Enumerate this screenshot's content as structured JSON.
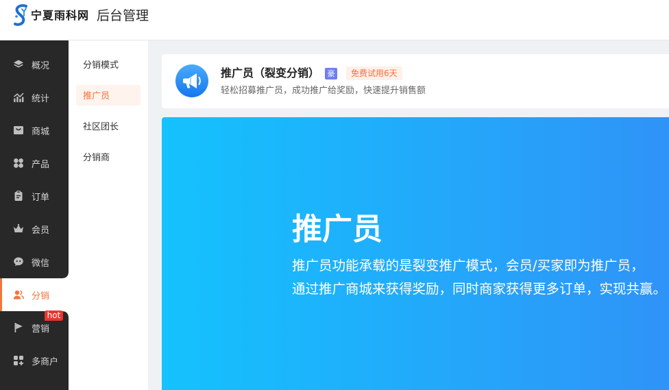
{
  "header": {
    "logo_text": "宁夏雨科网",
    "title": "后台管理"
  },
  "sidebar": {
    "items": [
      {
        "label": "概况",
        "icon": "layers-icon"
      },
      {
        "label": "统计",
        "icon": "chart-icon"
      },
      {
        "label": "商城",
        "icon": "shop-icon"
      },
      {
        "label": "产品",
        "icon": "grid-icon"
      },
      {
        "label": "订单",
        "icon": "clipboard-icon"
      },
      {
        "label": "会员",
        "icon": "crown-icon"
      },
      {
        "label": "微信",
        "icon": "wechat-icon"
      },
      {
        "label": "分销",
        "icon": "users-icon",
        "active": true
      },
      {
        "label": "营销",
        "icon": "flag-icon",
        "badge": "hot"
      },
      {
        "label": "多商户",
        "icon": "add-box-icon"
      }
    ]
  },
  "subnav": {
    "items": [
      {
        "label": "分销模式"
      },
      {
        "label": "推广员",
        "active": true
      },
      {
        "label": "社区团长"
      },
      {
        "label": "分销商"
      }
    ]
  },
  "plugin_card": {
    "icon": "megaphone-icon",
    "title": "推广员（裂变分销）",
    "edition_badge": "豪",
    "trial_badge": "免费试用6天",
    "description": "轻松招募推广员，成功推广给奖励，快速提升销售额"
  },
  "banner": {
    "title": "推广员",
    "lines": [
      "推广员功能承载的是裂变推广模式，会员/买家即为推广员，",
      "通过推广商城来获得奖励，同时商家获得更多订单，实现共赢。"
    ]
  },
  "colors": {
    "accent": "#f5743a",
    "sidebar_bg": "#282828",
    "hot_badge": "#e8362f",
    "edition_badge": "#6f7ef0",
    "banner_start": "#14c2fd",
    "banner_end": "#2f93f8"
  }
}
